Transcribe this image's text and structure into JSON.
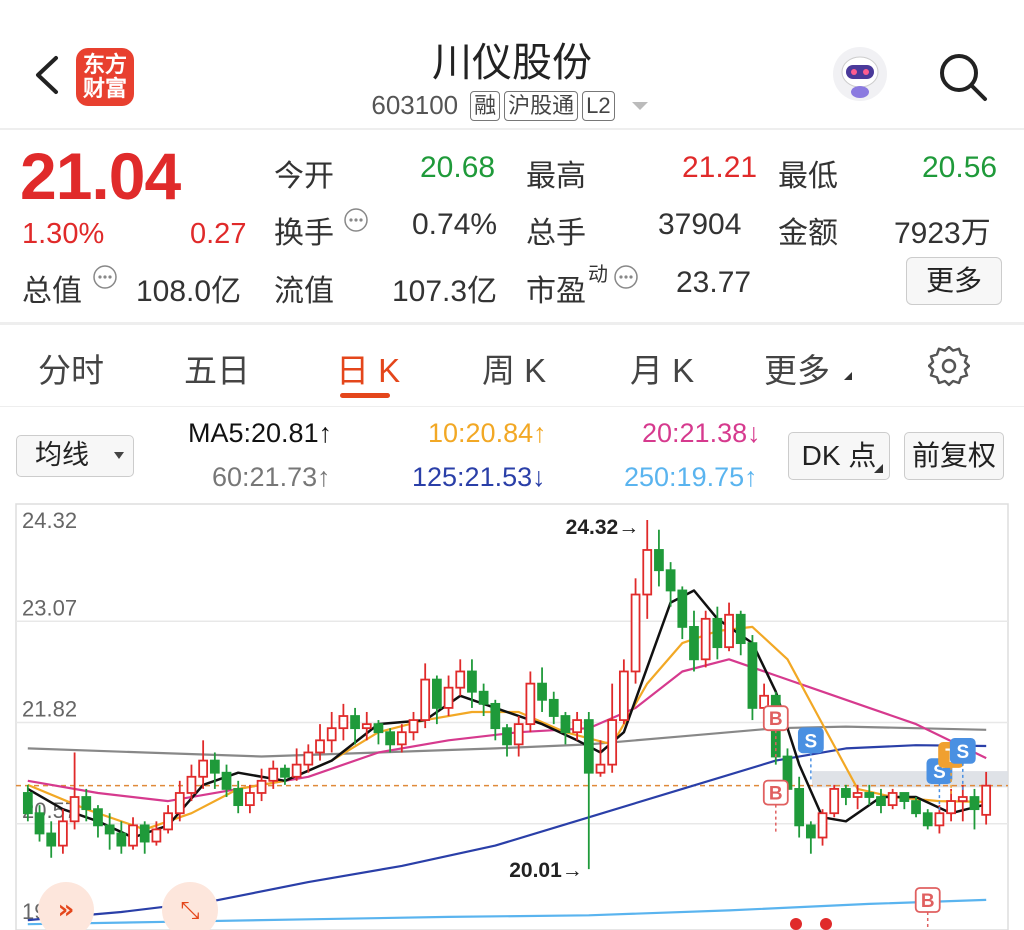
{
  "header": {
    "title": "川仪股份",
    "code": "603100",
    "tags": [
      "融",
      "沪股通",
      "L2"
    ],
    "logo_text": [
      "东方",
      "财富"
    ]
  },
  "quote": {
    "price": "21.04",
    "change_pct": "1.30%",
    "change": "0.27",
    "open_label": "今开",
    "open": "20.68",
    "high_label": "最高",
    "high": "21.21",
    "low_label": "最低",
    "low": "20.56",
    "turnover_label": "换手",
    "turnover": "0.74%",
    "volume_label": "总手",
    "volume": "37904",
    "amount_label": "金额",
    "amount": "7923万",
    "mktcap_label": "总值",
    "mktcap": "108.0亿",
    "float_label": "流值",
    "float": "107.3亿",
    "pe_label": "市盈",
    "pe_sup": "动",
    "pe": "23.77",
    "more_label": "更多"
  },
  "tabs": [
    {
      "label": "分时",
      "active": false
    },
    {
      "label": "五日",
      "active": false
    },
    {
      "label": "日 K",
      "active": true
    },
    {
      "label": "周 K",
      "active": false
    },
    {
      "label": "月 K",
      "active": false
    },
    {
      "label": "更多",
      "active": false
    }
  ],
  "toolbar": {
    "indicator_select": "均线",
    "dk_label": "DK 点",
    "adjust_label": "前复权"
  },
  "ma_values": {
    "ma5": "MA5:20.81↑",
    "ma10": "10:20.84↑",
    "ma20": "20:21.38↓",
    "ma60": "60:21.73↑",
    "ma125": "125:21.53↓",
    "ma250": "250:19.75↑"
  },
  "colors": {
    "up": "#e02a2a",
    "down": "#1f9a3a",
    "accent": "#e4461b",
    "ma5": "#111111",
    "ma10": "#f2a825",
    "ma20": "#d63a8e",
    "ma60": "#888888",
    "ma125": "#2a3fa8",
    "ma250": "#5ab4ef"
  },
  "chart_data": {
    "type": "candlestick",
    "y_ticks": [
      "24.32",
      "23.07",
      "21.82",
      "20.57",
      "19.32"
    ],
    "ylim": [
      19.32,
      24.32
    ],
    "high_marker": "24.32→",
    "low_marker": "20.01→",
    "last_close_ref": 21.04,
    "candles": [
      [
        20.95,
        20.7,
        21.05,
        20.6
      ],
      [
        20.7,
        20.45,
        20.8,
        20.35
      ],
      [
        20.45,
        20.3,
        20.6,
        20.15
      ],
      [
        20.3,
        20.6,
        20.75,
        20.2
      ],
      [
        20.6,
        20.9,
        21.45,
        20.5
      ],
      [
        20.9,
        20.75,
        21.0,
        20.6
      ],
      [
        20.75,
        20.55,
        20.8,
        20.4
      ],
      [
        20.55,
        20.45,
        20.7,
        20.25
      ],
      [
        20.45,
        20.3,
        20.6,
        20.2
      ],
      [
        20.3,
        20.55,
        20.65,
        20.25
      ],
      [
        20.55,
        20.35,
        20.6,
        20.2
      ],
      [
        20.35,
        20.5,
        20.6,
        20.3
      ],
      [
        20.5,
        20.7,
        20.8,
        20.45
      ],
      [
        20.7,
        20.95,
        21.1,
        20.6
      ],
      [
        20.95,
        21.15,
        21.3,
        20.85
      ],
      [
        21.15,
        21.35,
        21.6,
        21.0
      ],
      [
        21.35,
        21.2,
        21.45,
        21.0
      ],
      [
        21.2,
        21.0,
        21.3,
        20.9
      ],
      [
        21.0,
        20.8,
        21.1,
        20.7
      ],
      [
        20.8,
        20.95,
        21.05,
        20.7
      ],
      [
        20.95,
        21.1,
        21.25,
        20.85
      ],
      [
        21.1,
        21.25,
        21.35,
        21.0
      ],
      [
        21.25,
        21.15,
        21.3,
        21.05
      ],
      [
        21.15,
        21.3,
        21.5,
        21.1
      ],
      [
        21.3,
        21.45,
        21.55,
        21.2
      ],
      [
        21.45,
        21.6,
        21.8,
        21.35
      ],
      [
        21.6,
        21.75,
        21.95,
        21.45
      ],
      [
        21.75,
        21.9,
        22.05,
        21.6
      ],
      [
        21.9,
        21.75,
        22.0,
        21.55
      ],
      [
        21.75,
        21.8,
        21.95,
        21.6
      ],
      [
        21.8,
        21.7,
        21.85,
        21.55
      ],
      [
        21.7,
        21.55,
        21.75,
        21.45
      ],
      [
        21.55,
        21.7,
        21.8,
        21.45
      ],
      [
        21.7,
        21.85,
        21.95,
        21.6
      ],
      [
        21.85,
        22.35,
        22.55,
        21.75
      ],
      [
        22.35,
        22.0,
        22.4,
        21.8
      ],
      [
        22.0,
        22.25,
        22.4,
        21.9
      ],
      [
        22.25,
        22.45,
        22.6,
        22.15
      ],
      [
        22.45,
        22.2,
        22.6,
        22.0
      ],
      [
        22.2,
        22.05,
        22.3,
        21.9
      ],
      [
        22.05,
        21.75,
        22.1,
        21.6
      ],
      [
        21.75,
        21.55,
        21.8,
        21.4
      ],
      [
        21.55,
        21.8,
        21.9,
        21.4
      ],
      [
        21.8,
        22.3,
        22.45,
        21.7
      ],
      [
        22.3,
        22.1,
        22.5,
        21.95
      ],
      [
        22.1,
        21.9,
        22.2,
        21.8
      ],
      [
        21.9,
        21.7,
        21.95,
        21.55
      ],
      [
        21.7,
        21.85,
        21.95,
        21.6
      ],
      [
        21.85,
        21.2,
        21.95,
        20.01
      ],
      [
        21.2,
        21.3,
        21.6,
        21.15
      ],
      [
        21.3,
        21.85,
        22.3,
        21.2
      ],
      [
        21.85,
        22.45,
        22.6,
        21.8
      ],
      [
        22.45,
        23.4,
        23.6,
        22.3
      ],
      [
        23.4,
        23.95,
        24.32,
        23.1
      ],
      [
        23.95,
        23.7,
        24.2,
        23.5
      ],
      [
        23.7,
        23.45,
        23.8,
        23.25
      ],
      [
        23.45,
        23.0,
        23.5,
        22.85
      ],
      [
        23.0,
        22.6,
        23.2,
        22.45
      ],
      [
        22.6,
        23.1,
        23.2,
        22.5
      ],
      [
        23.1,
        22.75,
        23.25,
        22.6
      ],
      [
        22.75,
        23.15,
        23.3,
        22.7
      ],
      [
        23.15,
        22.8,
        23.2,
        22.65
      ],
      [
        22.8,
        22.0,
        22.9,
        21.85
      ],
      [
        22.0,
        22.15,
        22.3,
        21.9
      ],
      [
        22.15,
        21.4,
        22.2,
        21.3
      ],
      [
        21.4,
        21.0,
        21.5,
        20.85
      ],
      [
        21.0,
        20.55,
        21.15,
        20.4
      ],
      [
        20.55,
        20.4,
        20.6,
        20.2
      ],
      [
        20.4,
        20.7,
        20.75,
        20.3
      ],
      [
        20.7,
        21.0,
        21.05,
        20.65
      ],
      [
        21.0,
        20.9,
        21.05,
        20.8
      ],
      [
        20.9,
        20.95,
        21.05,
        20.75
      ],
      [
        20.95,
        20.9,
        21.05,
        20.8
      ],
      [
        20.9,
        20.8,
        21.0,
        20.7
      ],
      [
        20.8,
        20.95,
        21.0,
        20.75
      ],
      [
        20.95,
        20.85,
        20.95,
        20.75
      ],
      [
        20.85,
        20.7,
        20.9,
        20.65
      ],
      [
        20.7,
        20.55,
        20.75,
        20.5
      ],
      [
        20.55,
        20.7,
        20.8,
        20.45
      ],
      [
        20.7,
        20.85,
        21.0,
        20.6
      ],
      [
        20.85,
        20.9,
        21.05,
        20.6
      ],
      [
        20.9,
        20.75,
        21.0,
        20.5
      ],
      [
        20.68,
        21.04,
        21.21,
        20.56
      ]
    ],
    "ma_lines": {
      "ma250": [
        [
          0,
          19.33
        ],
        [
          12,
          19.36
        ],
        [
          24,
          19.39
        ],
        [
          36,
          19.42
        ],
        [
          48,
          19.44
        ],
        [
          60,
          19.5
        ],
        [
          72,
          19.58
        ],
        [
          82,
          19.63
        ]
      ],
      "ma125": [
        [
          0,
          19.38
        ],
        [
          8,
          19.48
        ],
        [
          16,
          19.62
        ],
        [
          24,
          19.85
        ],
        [
          32,
          20.05
        ],
        [
          40,
          20.3
        ],
        [
          48,
          20.65
        ],
        [
          56,
          21.0
        ],
        [
          64,
          21.35
        ],
        [
          70,
          21.5
        ],
        [
          76,
          21.54
        ],
        [
          82,
          21.53
        ]
      ],
      "ma60": [
        [
          0,
          21.5
        ],
        [
          10,
          21.45
        ],
        [
          20,
          21.4
        ],
        [
          30,
          21.45
        ],
        [
          40,
          21.5
        ],
        [
          48,
          21.55
        ],
        [
          56,
          21.65
        ],
        [
          64,
          21.75
        ],
        [
          70,
          21.77
        ],
        [
          82,
          21.73
        ]
      ],
      "ma20": [
        [
          0,
          21.1
        ],
        [
          6,
          20.95
        ],
        [
          12,
          20.85
        ],
        [
          18,
          21.0
        ],
        [
          24,
          21.15
        ],
        [
          30,
          21.45
        ],
        [
          36,
          21.6
        ],
        [
          42,
          21.7
        ],
        [
          48,
          21.75
        ],
        [
          52,
          22.0
        ],
        [
          56,
          22.45
        ],
        [
          60,
          22.6
        ],
        [
          64,
          22.4
        ],
        [
          68,
          22.2
        ],
        [
          72,
          22.0
        ],
        [
          76,
          21.8
        ],
        [
          82,
          21.38
        ]
      ],
      "ma10": [
        [
          0,
          21.05
        ],
        [
          5,
          20.75
        ],
        [
          10,
          20.5
        ],
        [
          14,
          20.7
        ],
        [
          18,
          21.0
        ],
        [
          22,
          21.1
        ],
        [
          26,
          21.35
        ],
        [
          30,
          21.7
        ],
        [
          34,
          21.85
        ],
        [
          38,
          21.95
        ],
        [
          42,
          21.95
        ],
        [
          46,
          21.7
        ],
        [
          50,
          21.55
        ],
        [
          53,
          22.3
        ],
        [
          56,
          22.8
        ],
        [
          59,
          22.95
        ],
        [
          62,
          23.0
        ],
        [
          65,
          22.6
        ],
        [
          68,
          21.8
        ],
        [
          71,
          21.0
        ],
        [
          74,
          20.9
        ],
        [
          78,
          20.85
        ],
        [
          82,
          20.84
        ]
      ],
      "ma5": [
        [
          0,
          21.0
        ],
        [
          3,
          20.75
        ],
        [
          6,
          20.6
        ],
        [
          9,
          20.4
        ],
        [
          12,
          20.55
        ],
        [
          15,
          21.05
        ],
        [
          18,
          21.2
        ],
        [
          22,
          21.1
        ],
        [
          26,
          21.35
        ],
        [
          30,
          21.8
        ],
        [
          34,
          21.85
        ],
        [
          37,
          22.15
        ],
        [
          40,
          22.0
        ],
        [
          44,
          21.8
        ],
        [
          47,
          21.6
        ],
        [
          49,
          21.45
        ],
        [
          51,
          21.7
        ],
        [
          53,
          22.5
        ],
        [
          55,
          23.3
        ],
        [
          57,
          23.45
        ],
        [
          59,
          23.1
        ],
        [
          62,
          22.8
        ],
        [
          64,
          22.2
        ],
        [
          66,
          21.3
        ],
        [
          68,
          20.65
        ],
        [
          70,
          20.6
        ],
        [
          73,
          20.9
        ],
        [
          76,
          20.9
        ],
        [
          79,
          20.7
        ],
        [
          82,
          20.81
        ]
      ]
    },
    "signals": [
      {
        "label": "B",
        "candle": 64,
        "pos": "above"
      },
      {
        "label": "S",
        "candle": 67,
        "pos": "above"
      },
      {
        "label": "B",
        "candle": 64,
        "pos": "below"
      },
      {
        "label": "S",
        "candle": 78,
        "pos": "above"
      },
      {
        "label": "T",
        "candle": 79,
        "pos": "above"
      },
      {
        "label": "S",
        "candle": 80,
        "pos": "above"
      },
      {
        "label": "B",
        "candle": 77,
        "pos": "bottom"
      }
    ]
  }
}
